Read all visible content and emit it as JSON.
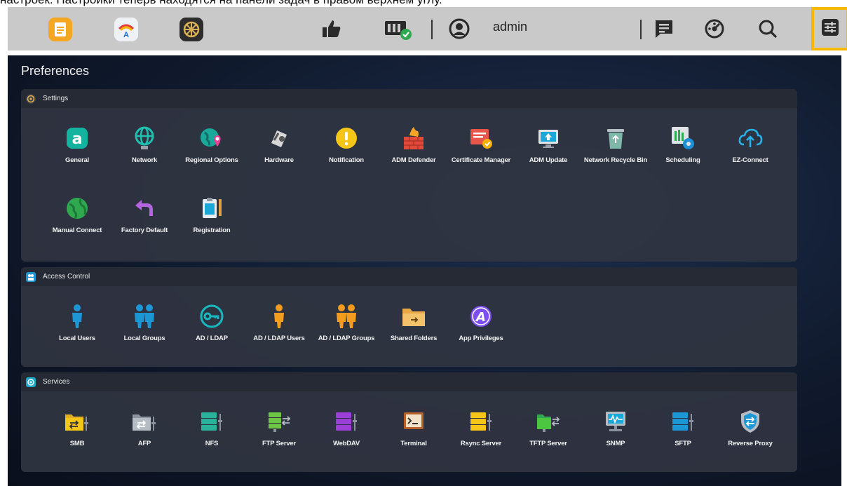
{
  "caption": "настроек. Настройки теперь находятся на панели задач в правом верхнем углу.",
  "taskbar": {
    "apps": [
      {
        "icon": "file-note-app-icon"
      },
      {
        "icon": "app-central-icon"
      },
      {
        "icon": "wheel-app-icon"
      }
    ],
    "icons": [
      {
        "icon": "thumbs-up-icon"
      },
      {
        "icon": "storage-status-icon"
      }
    ],
    "user_label": "admin",
    "right_icons": [
      {
        "icon": "message-icon"
      },
      {
        "icon": "dashboard-icon"
      },
      {
        "icon": "search-icon"
      },
      {
        "icon": "preferences-icon"
      }
    ],
    "highlight_color": "#f6b800"
  },
  "preferences": {
    "title": "Preferences",
    "settings": {
      "header": "Settings",
      "items": [
        {
          "label": "General",
          "icon": "general-icon"
        },
        {
          "label": "Network",
          "icon": "network-icon"
        },
        {
          "label": "Regional Options",
          "icon": "regional-options-icon"
        },
        {
          "label": "Hardware",
          "icon": "hardware-icon"
        },
        {
          "label": "Notification",
          "icon": "notification-icon"
        },
        {
          "label": "ADM Defender",
          "icon": "adm-defender-icon"
        },
        {
          "label": "Certificate Manager",
          "icon": "certificate-manager-icon"
        },
        {
          "label": "ADM Update",
          "icon": "adm-update-icon"
        },
        {
          "label": "Network Recycle Bin",
          "icon": "recycle-bin-icon"
        },
        {
          "label": "Scheduling",
          "icon": "scheduling-icon"
        },
        {
          "label": "EZ-Connect",
          "icon": "ez-connect-icon"
        },
        {
          "label": "Manual Connect",
          "icon": "manual-connect-icon"
        },
        {
          "label": "Factory Default",
          "icon": "factory-default-icon"
        },
        {
          "label": "Registration",
          "icon": "registration-icon"
        }
      ]
    },
    "access_control": {
      "header": "Access Control",
      "items": [
        {
          "label": "Local Users",
          "icon": "local-users-icon"
        },
        {
          "label": "Local Groups",
          "icon": "local-groups-icon"
        },
        {
          "label": "AD / LDAP",
          "icon": "ad-ldap-icon"
        },
        {
          "label": "AD / LDAP Users",
          "icon": "ad-ldap-users-icon"
        },
        {
          "label": "AD / LDAP Groups",
          "icon": "ad-ldap-groups-icon"
        },
        {
          "label": "Shared Folders",
          "icon": "shared-folders-icon"
        },
        {
          "label": "App Privileges",
          "icon": "app-privileges-icon"
        }
      ]
    },
    "services": {
      "header": "Services",
      "items": [
        {
          "label": "SMB",
          "icon": "smb-icon"
        },
        {
          "label": "AFP",
          "icon": "afp-icon"
        },
        {
          "label": "NFS",
          "icon": "nfs-icon"
        },
        {
          "label": "FTP Server",
          "icon": "ftp-server-icon"
        },
        {
          "label": "WebDAV",
          "icon": "webdav-icon"
        },
        {
          "label": "Terminal",
          "icon": "terminal-icon"
        },
        {
          "label": "Rsync Server",
          "icon": "rsync-server-icon"
        },
        {
          "label": "TFTP Server",
          "icon": "tftp-server-icon"
        },
        {
          "label": "SNMP",
          "icon": "snmp-icon"
        },
        {
          "label": "SFTP",
          "icon": "sftp-icon"
        },
        {
          "label": "Reverse Proxy",
          "icon": "reverse-proxy-icon"
        }
      ]
    }
  }
}
